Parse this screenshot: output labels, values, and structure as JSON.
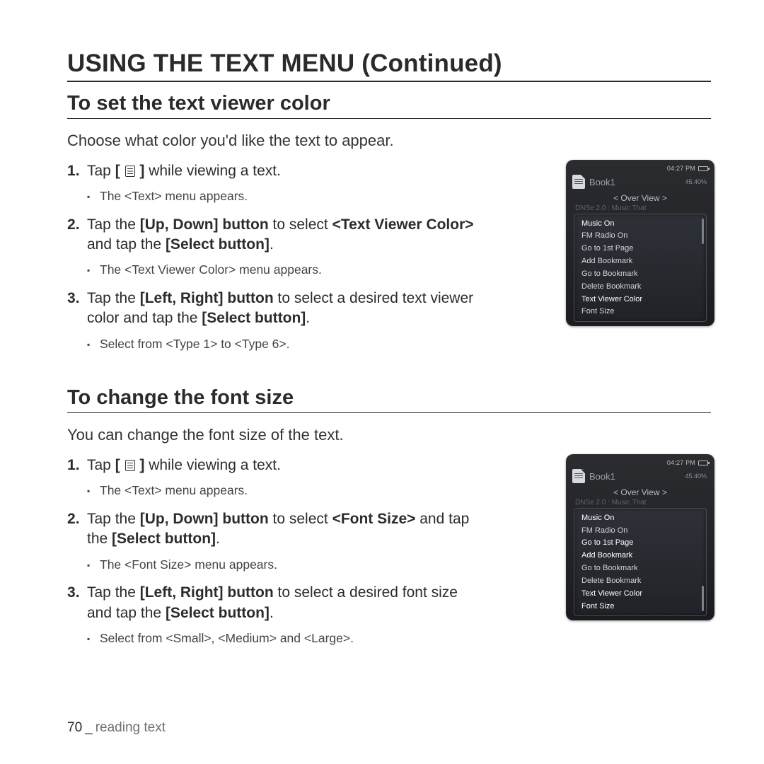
{
  "page_title": "USING THE TEXT MENU (Continued)",
  "section1": {
    "heading": "To set the text viewer color",
    "intro": "Choose what color you'd like the text to appear.",
    "step1_pre": "Tap ",
    "step1_post": " while viewing a text.",
    "step1_sub": "The <Text> menu appears.",
    "step2_a": "Tap the ",
    "step2_b": "[Up, Down] button",
    "step2_c": " to select ",
    "step2_d": "<Text Viewer Color>",
    "step2_e": " and tap the ",
    "step2_f": "[Select button]",
    "step2_g": ".",
    "step2_sub": "The <Text Viewer Color> menu appears.",
    "step3_a": "Tap the ",
    "step3_b": "[Left, Right] button",
    "step3_c": " to select a desired text viewer color and tap the ",
    "step3_d": "[Select button]",
    "step3_e": ".",
    "step3_sub": "Select from <Type 1> to <Type 6>."
  },
  "section2": {
    "heading": "To change the font size",
    "intro": "You can change the font size of the text.",
    "step1_pre": "Tap ",
    "step1_post": " while viewing a text.",
    "step1_sub": "The <Text> menu appears.",
    "step2_a": "Tap the ",
    "step2_b": "[Up, Down] button",
    "step2_c": " to select ",
    "step2_d": "<Font Size>",
    "step2_e": " and tap the ",
    "step2_f": "[Select button]",
    "step2_g": ".",
    "step2_sub": "The <Font Size> menu appears.",
    "step3_a": "Tap the ",
    "step3_b": "[Left, Right] button",
    "step3_c": " to select a desired font size and tap the ",
    "step3_d": "[Select button]",
    "step3_e": ".",
    "step3_sub": "Select from <Small>, <Medium> and <Large>."
  },
  "device": {
    "time": "04:27 PM",
    "filename": "Book1",
    "percent": "45.40%",
    "overview": "< Over View >",
    "faint": "DNSe 2.0 : Music That",
    "menu_items": [
      "Music On",
      "FM Radio On",
      "Go to 1st Page",
      "Add Bookmark",
      "Go to Bookmark",
      "Delete Bookmark",
      "Text Viewer Color",
      "Font Size"
    ]
  },
  "footer": {
    "page_number": "70",
    "chapter": "reading text"
  },
  "icons": {
    "menu_button": "[ menu ]"
  }
}
